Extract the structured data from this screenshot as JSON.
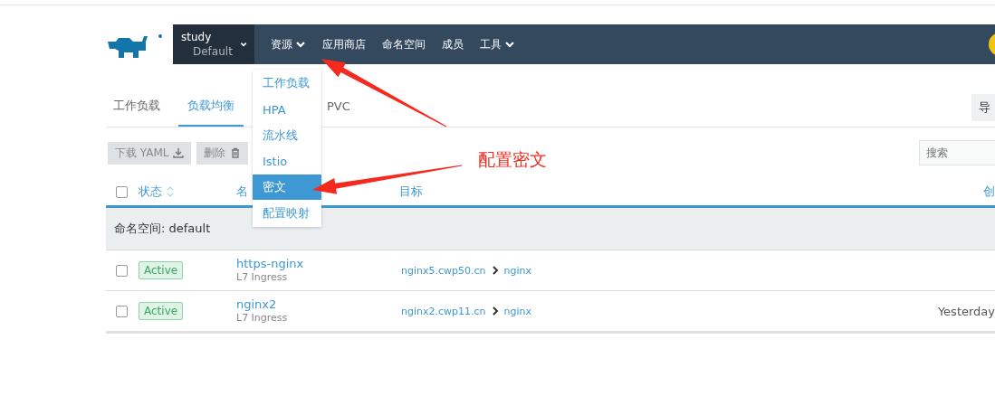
{
  "header": {
    "project": {
      "name": "study",
      "namespace": "Default"
    },
    "nav": [
      {
        "label": "资源",
        "dropdown": true
      },
      {
        "label": "应用商店",
        "dropdown": false
      },
      {
        "label": "命名空间",
        "dropdown": false
      },
      {
        "label": "成员",
        "dropdown": false
      },
      {
        "label": "工具",
        "dropdown": true
      }
    ]
  },
  "menu": {
    "items": [
      {
        "label": "工作负载",
        "selected": false
      },
      {
        "label": "HPA",
        "selected": false
      },
      {
        "label": "流水线",
        "selected": false
      },
      {
        "label": "Istio",
        "selected": false
      },
      {
        "label": "密文",
        "selected": true
      },
      {
        "label": "配置映射",
        "selected": false
      }
    ]
  },
  "tabs": [
    {
      "label": "工作负载",
      "selected": false
    },
    {
      "label": "负载均衡",
      "selected": true
    },
    {
      "label": "PVC",
      "selected": false
    }
  ],
  "toolbar": {
    "action": "导",
    "buttons": [
      {
        "label": "下载 YAML",
        "kind": "download"
      },
      {
        "label": "删除",
        "kind": "delete"
      }
    ],
    "search": {
      "placeholder": "搜索"
    }
  },
  "table": {
    "select_all": false,
    "columns": [
      "状态",
      "名",
      "目标",
      "创"
    ],
    "group": "命名空间: default",
    "rows": [
      {
        "checked": false,
        "state": "Active",
        "name": "https-nginx",
        "type": "L7 Ingress",
        "host": "nginx5.cwp50.cn",
        "target": "nginx"
      },
      {
        "checked": false,
        "state": "Active",
        "name": "nginx2",
        "type": "L7 Ingress",
        "host": "nginx2.cwp11.cn",
        "target": "nginx",
        "created": "Yesterday"
      }
    ]
  },
  "annotation": {
    "text": "配置密文"
  }
}
